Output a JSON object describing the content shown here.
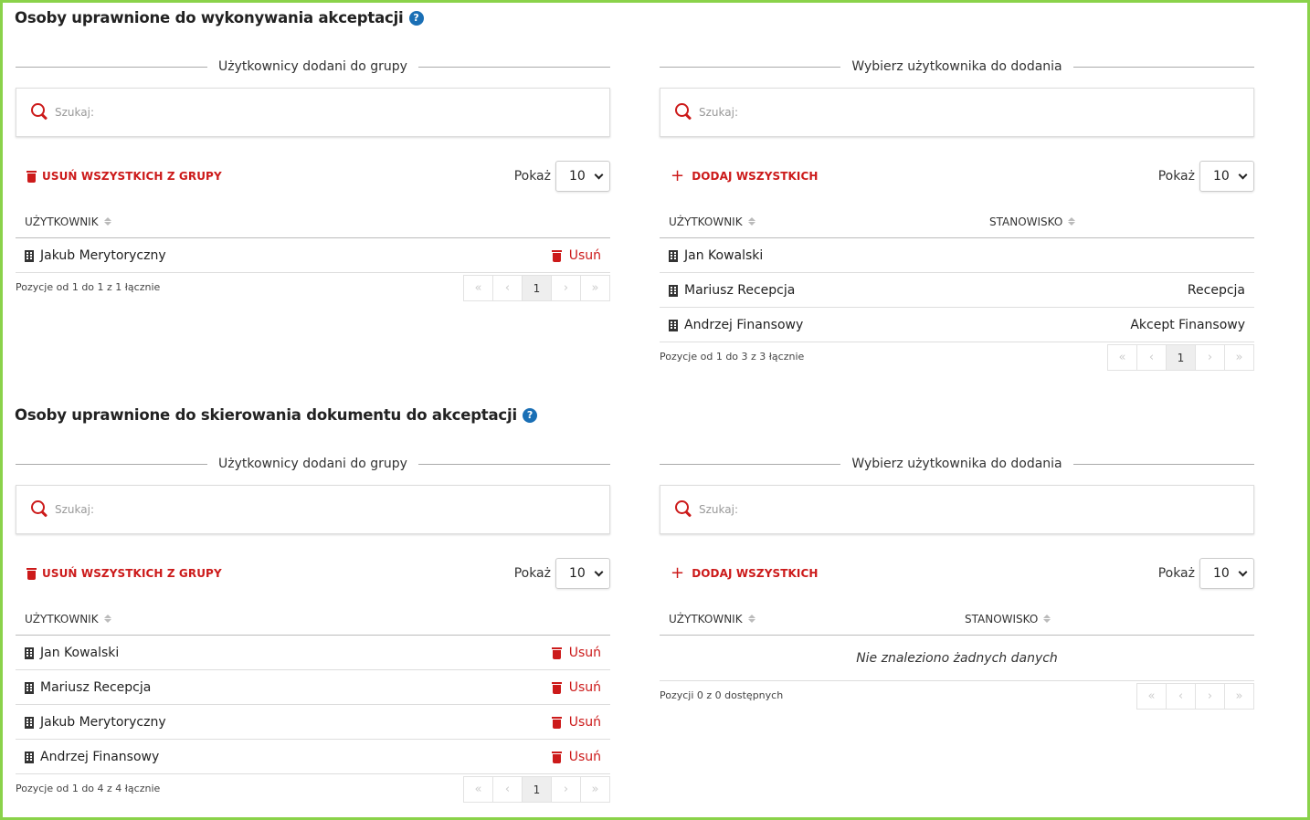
{
  "sections": [
    {
      "title": "Osoby uprawnione do wykonywania akceptacji",
      "left": {
        "heading": "Użytkownicy dodani do grupy",
        "search_placeholder": "Szukaj:",
        "action_label": "USUŃ WSZYSTKICH Z GRUPY",
        "show_label": "Pokaż",
        "show_value": "10",
        "col_user": "UŻYTKOWNIK",
        "rows": [
          {
            "name": "Jakub Merytoryczny",
            "action": "Usuń"
          }
        ],
        "info": "Pozycje od 1 do 1 z 1 łącznie",
        "page": "1"
      },
      "right": {
        "heading": "Wybierz użytkownika do dodania",
        "search_placeholder": "Szukaj:",
        "action_label": "DODAJ WSZYSTKICH",
        "show_label": "Pokaż",
        "show_value": "10",
        "col_user": "UŻYTKOWNIK",
        "col_position": "STANOWISKO",
        "rows": [
          {
            "name": "Jan Kowalski",
            "position": ""
          },
          {
            "name": "Mariusz Recepcja",
            "position": "Recepcja"
          },
          {
            "name": "Andrzej Finansowy",
            "position": "Akcept Finansowy"
          }
        ],
        "info": "Pozycje od 1 do 3 z 3 łącznie",
        "page": "1"
      }
    },
    {
      "title": "Osoby uprawnione do skierowania dokumentu do akceptacji",
      "left": {
        "heading": "Użytkownicy dodani do grupy",
        "search_placeholder": "Szukaj:",
        "action_label": "USUŃ WSZYSTKICH Z GRUPY",
        "show_label": "Pokaż",
        "show_value": "10",
        "col_user": "UŻYTKOWNIK",
        "rows": [
          {
            "name": "Jan Kowalski",
            "action": "Usuń"
          },
          {
            "name": "Mariusz Recepcja",
            "action": "Usuń"
          },
          {
            "name": "Jakub Merytoryczny",
            "action": "Usuń"
          },
          {
            "name": "Andrzej Finansowy",
            "action": "Usuń"
          }
        ],
        "info": "Pozycje od 1 do 4 z 4 łącznie",
        "page": "1"
      },
      "right": {
        "heading": "Wybierz użytkownika do dodania",
        "search_placeholder": "Szukaj:",
        "action_label": "DODAJ WSZYSTKICH",
        "show_label": "Pokaż",
        "show_value": "10",
        "col_user": "UŻYTKOWNIK",
        "col_position": "STANOWISKO",
        "empty_text": "Nie znaleziono żadnych danych",
        "info": "Pozycji 0 z 0 dostępnych"
      }
    }
  ],
  "pager_glyphs": {
    "first": "«",
    "prev": "‹",
    "next": "›",
    "last": "»"
  },
  "help_glyph": "?",
  "accent_color": "#cc1a1a",
  "help_color": "#1a6fb5",
  "frame_color": "#8ad24a"
}
